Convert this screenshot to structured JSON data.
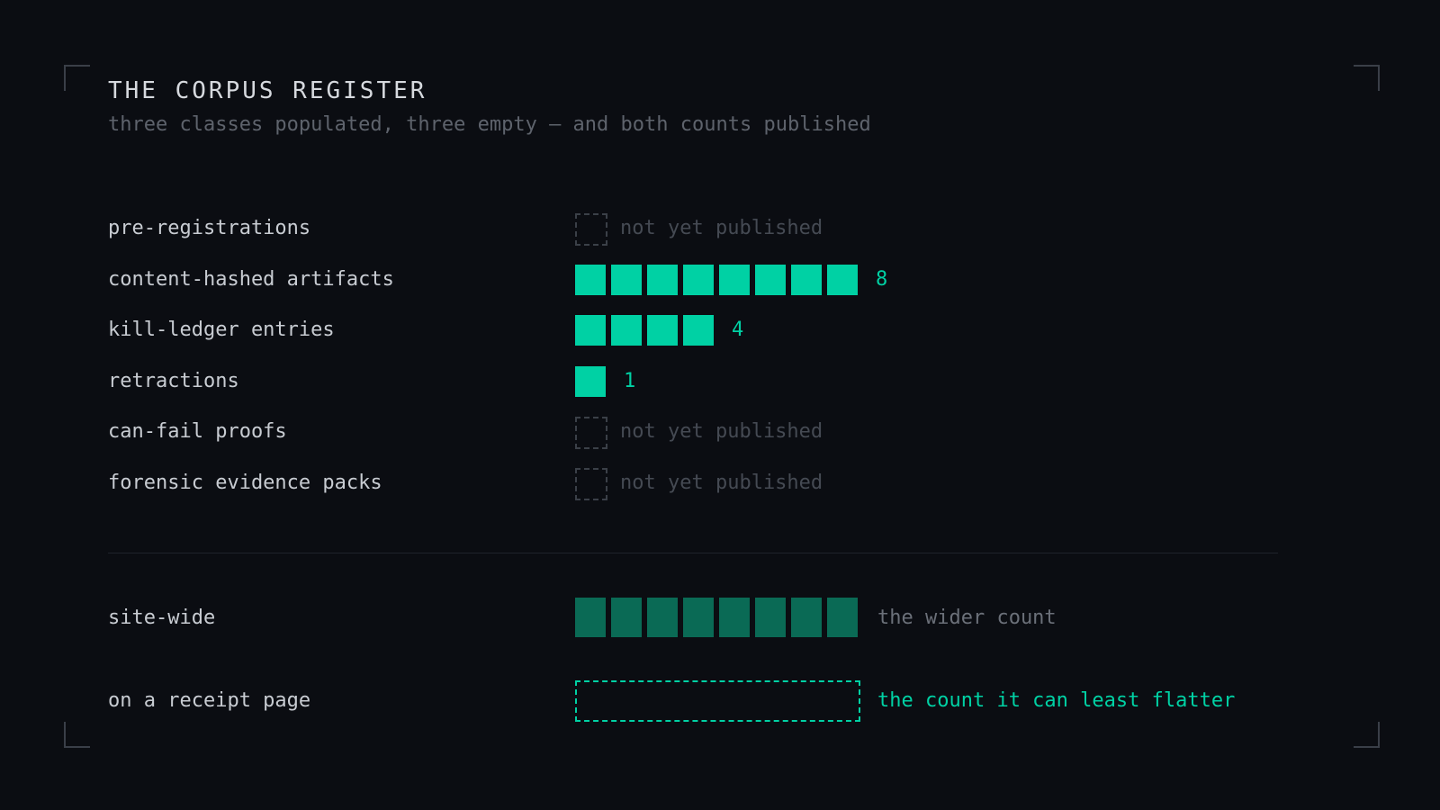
{
  "colors": {
    "background": "#0b0d12",
    "accent": "#00d1a4",
    "accent_dim": "#0a6a55",
    "label": "#c8ccd2",
    "muted": "#5e636c",
    "empty": "#454a53"
  },
  "header": {
    "title": "THE CORPUS REGISTER",
    "subtitle": "three classes populated, three empty — and both counts published"
  },
  "chart_data": {
    "type": "bar",
    "title": "THE CORPUS REGISTER",
    "subtitle": "three classes populated, three empty — and both counts published",
    "categories": [
      "pre-registrations",
      "content-hashed artifacts",
      "kill-ledger entries",
      "retractions",
      "can-fail proofs",
      "forensic evidence packs"
    ],
    "values": [
      null,
      8,
      4,
      1,
      null,
      null
    ],
    "empty_label": "not yet published",
    "orientation": "horizontal",
    "grid": false
  },
  "rows": [
    {
      "label": "pre-registrations",
      "value": null,
      "note": "not yet published"
    },
    {
      "label": "content-hashed artifacts",
      "value": 8,
      "note": "8"
    },
    {
      "label": "kill-ledger entries",
      "value": 4,
      "note": "4"
    },
    {
      "label": "retractions",
      "value": 1,
      "note": "1"
    },
    {
      "label": "can-fail proofs",
      "value": null,
      "note": "not yet published"
    },
    {
      "label": "forensic evidence packs",
      "value": null,
      "note": "not yet published"
    }
  ],
  "comparison": {
    "site_wide": {
      "label": "site-wide",
      "value": 8,
      "note": "the wider count"
    },
    "receipt": {
      "label": "on a receipt page",
      "value": null,
      "note": "the count it can least flatter"
    }
  }
}
